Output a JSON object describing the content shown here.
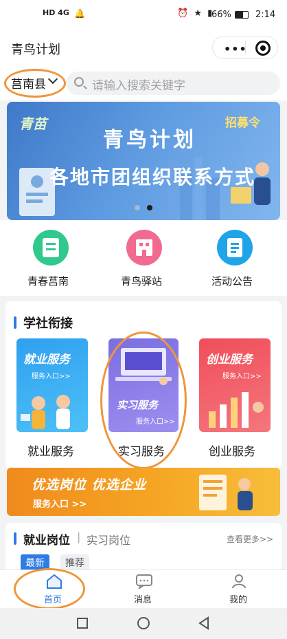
{
  "status_bar": {
    "network": "HD 4G",
    "battery_percent": "66%",
    "time": "2:14"
  },
  "header": {
    "title": "青鸟计划"
  },
  "search": {
    "region": "莒南县",
    "placeholder": "请输入搜索关键字"
  },
  "banner": {
    "logo_text": "青苗",
    "headline": "青鸟计划",
    "subline": "各地市团组织联系方式",
    "corner_badge": "招募令",
    "active_index": 1,
    "dot_count": 2
  },
  "quick_links": [
    {
      "label": "青春莒南",
      "icon": "book-icon",
      "color": "#2fc98e"
    },
    {
      "label": "青鸟驿站",
      "icon": "building-icon",
      "color": "#f06b8f"
    },
    {
      "label": "活动公告",
      "icon": "notice-icon",
      "color": "#1fa4e8"
    }
  ],
  "section": {
    "title": "学社衔接",
    "cards": [
      {
        "caption_top": "就业服务",
        "entry_text": "服务入口>>",
        "label": "就业服务"
      },
      {
        "caption_top": "实习服务",
        "entry_text": "服务入口>>",
        "label": "实习服务"
      },
      {
        "caption_top": "创业服务",
        "entry_text": "服务入口>>",
        "label": "创业服务"
      }
    ]
  },
  "promo": {
    "line1": "优选岗位  优选企业",
    "line2": "服务入口 >>"
  },
  "jobs": {
    "tab_active": "就业岗位",
    "separator": "|",
    "tab_inactive": "实习岗位",
    "more": "查看更多>>",
    "filters": [
      "最新",
      "推荐"
    ]
  },
  "tabbar": {
    "items": [
      {
        "label": "首页",
        "icon": "home-icon",
        "active": true
      },
      {
        "label": "消息",
        "icon": "message-icon",
        "active": false
      },
      {
        "label": "我的",
        "icon": "user-icon",
        "active": false
      }
    ]
  },
  "colors": {
    "accent": "#2d7be5",
    "annotation_ring": "#f0953b",
    "promo": "#f5a623"
  }
}
